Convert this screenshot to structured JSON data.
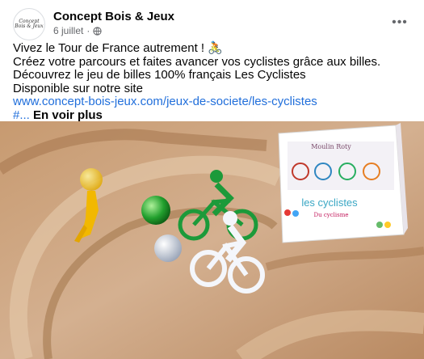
{
  "post": {
    "page_name": "Concept Bois & Jeux",
    "avatar_line1": "Concept",
    "avatar_line2": "Bois & Jeux",
    "date": "6 juillet",
    "more_label": "•••",
    "text_lines": [
      "Vivez le Tour de France autrement ! 🚴",
      "Créez votre parcours et faites avancer vos cyclistes grâce aux billes.",
      "Découvrez le jeu de billes 100% français Les Cyclistes",
      "Disponible sur notre site"
    ],
    "link": "www.concept-bois-jeux.com/jeux-de-societe/les-cyclistes",
    "hashtag_prefix": "#...",
    "see_more": "En voir plus"
  },
  "image": {
    "box_brand": "Moulin Roty",
    "box_title": "les cyclistes",
    "box_subtitle": "Du cyclisme"
  },
  "colors": {
    "link": "#216fdb",
    "text": "#050505",
    "muted": "#65676b",
    "sand": "#c9a27b"
  }
}
